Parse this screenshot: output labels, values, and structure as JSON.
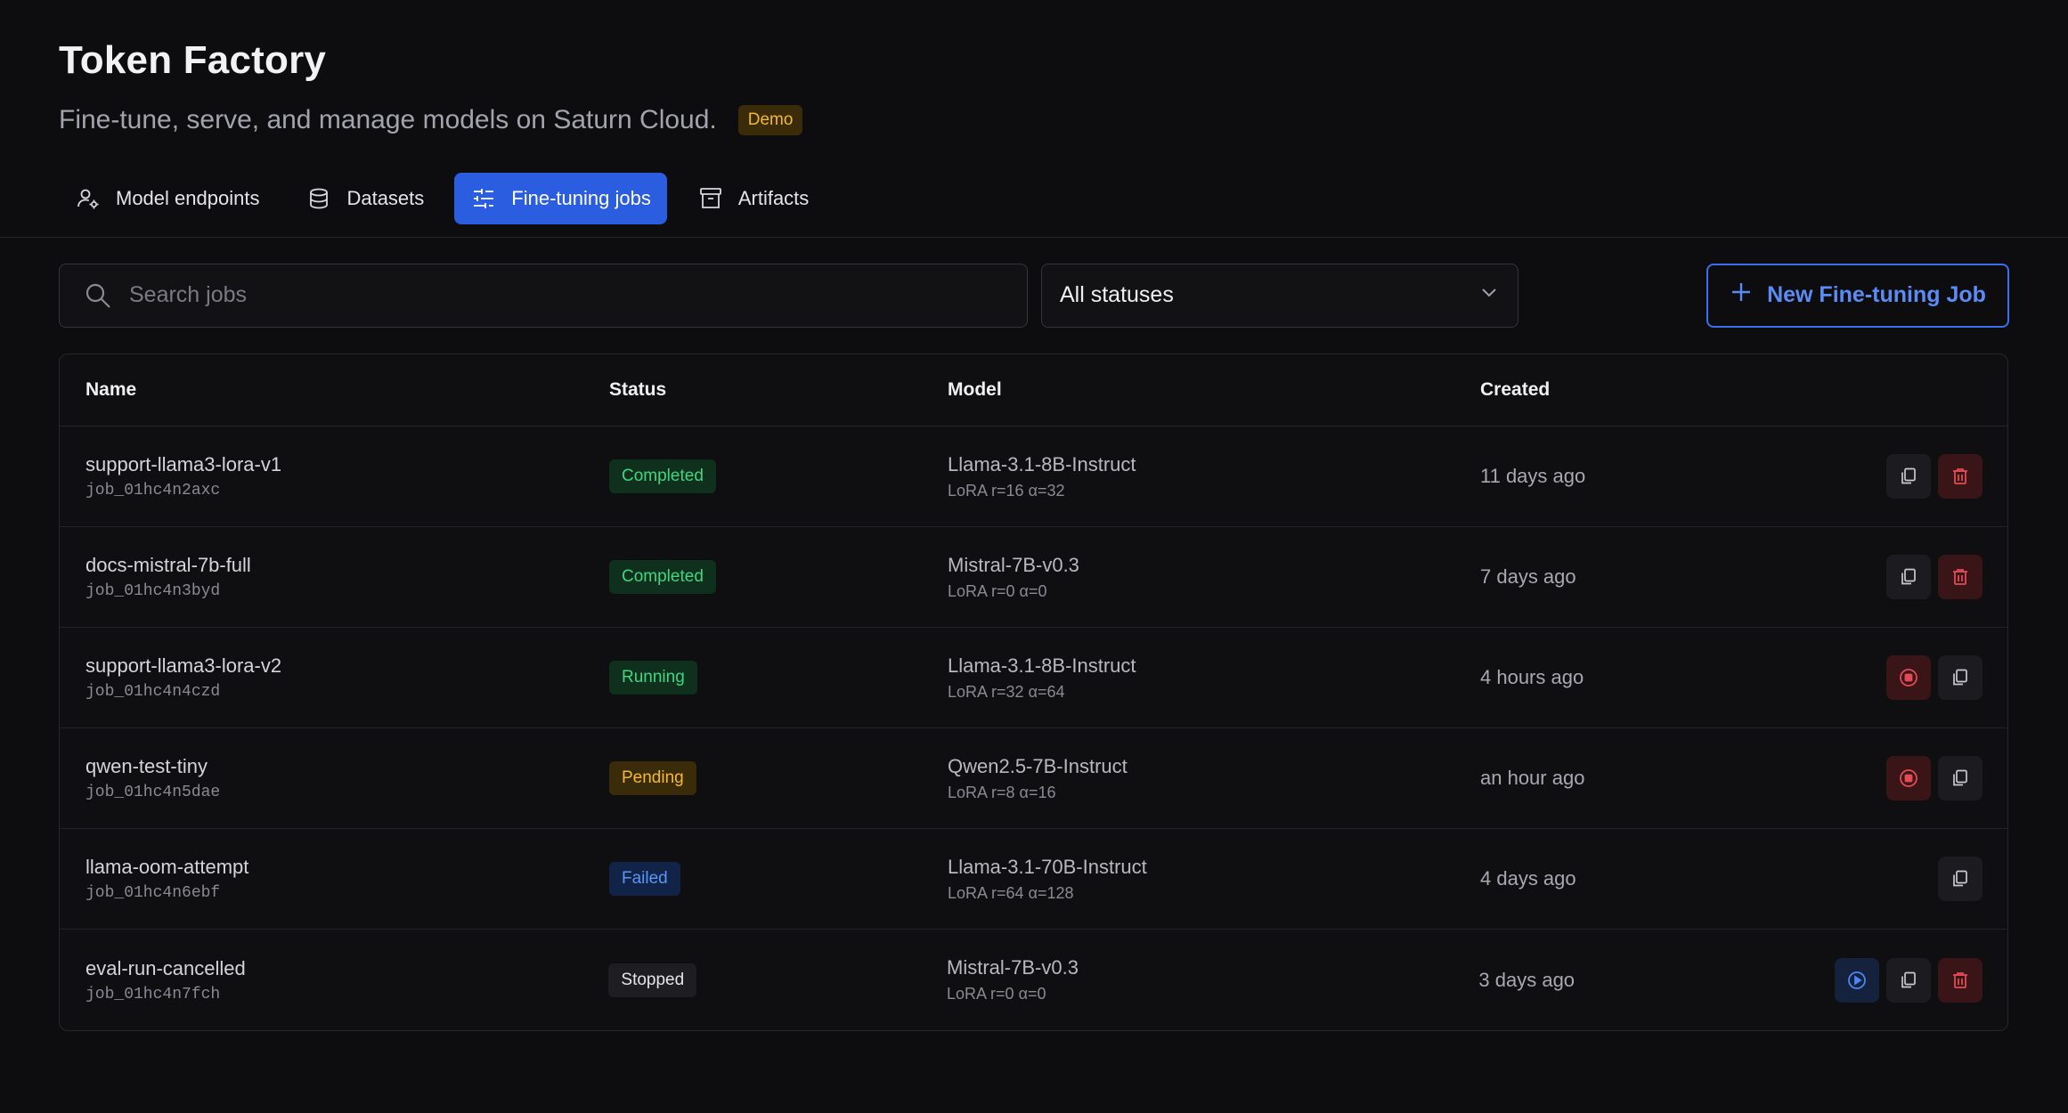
{
  "app": {
    "title": "Token Factory",
    "subtitle": "Fine-tune, serve, and manage models on Saturn Cloud.",
    "badge": "Demo"
  },
  "tabs": [
    {
      "label": "Model endpoints",
      "icon": "user-gear-icon",
      "active": false
    },
    {
      "label": "Datasets",
      "icon": "database-icon",
      "active": false
    },
    {
      "label": "Fine-tuning jobs",
      "icon": "sliders-icon",
      "active": true
    },
    {
      "label": "Artifacts",
      "icon": "archive-icon",
      "active": false
    }
  ],
  "toolbar": {
    "search_placeholder": "Search jobs",
    "status_filter": "All statuses",
    "new_button": "New Fine-tuning Job"
  },
  "table": {
    "columns": [
      "Name",
      "Status",
      "Model",
      "Created"
    ],
    "rows": [
      {
        "name": "support-llama3-lora-v1",
        "id": "job_01hc4n2axc",
        "status": "Completed",
        "model": "Llama-3.1-8B-Instruct",
        "config": "LoRA r=16 α=32",
        "created": "11 days ago",
        "actions": [
          "copy",
          "delete"
        ]
      },
      {
        "name": "docs-mistral-7b-full",
        "id": "job_01hc4n3byd",
        "status": "Completed",
        "model": "Mistral-7B-v0.3",
        "config": "LoRA r=0 α=0",
        "created": "7 days ago",
        "actions": [
          "copy",
          "delete"
        ]
      },
      {
        "name": "support-llama3-lora-v2",
        "id": "job_01hc4n4czd",
        "status": "Running",
        "model": "Llama-3.1-8B-Instruct",
        "config": "LoRA r=32 α=64",
        "created": "4 hours ago",
        "actions": [
          "stop",
          "copy"
        ]
      },
      {
        "name": "qwen-test-tiny",
        "id": "job_01hc4n5dae",
        "status": "Pending",
        "model": "Qwen2.5-7B-Instruct",
        "config": "LoRA r=8 α=16",
        "created": "an hour ago",
        "actions": [
          "stop",
          "copy"
        ]
      },
      {
        "name": "llama-oom-attempt",
        "id": "job_01hc4n6ebf",
        "status": "Failed",
        "model": "Llama-3.1-70B-Instruct",
        "config": "LoRA r=64 α=128",
        "created": "4 days ago",
        "actions": [
          "copy"
        ]
      },
      {
        "name": "eval-run-cancelled",
        "id": "job_01hc4n7fch",
        "status": "Stopped",
        "model": "Mistral-7B-v0.3",
        "config": "LoRA r=0 α=0",
        "created": "3 days ago",
        "actions": [
          "resume",
          "copy",
          "delete"
        ]
      }
    ]
  },
  "colors": {
    "background": "#0d0d0f",
    "accent": "#2b5de0",
    "success": "#3fd680",
    "warning": "#f5b731",
    "danger": "#e04b55",
    "info": "#5b95f5"
  }
}
